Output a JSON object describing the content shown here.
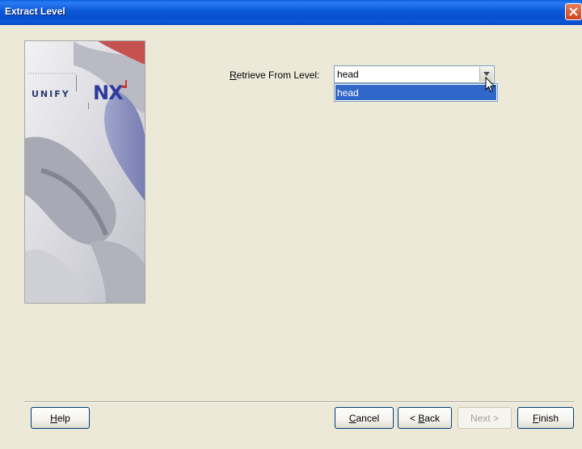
{
  "window": {
    "title": "Extract Level"
  },
  "banner": {
    "logo_word": "UNIFY",
    "logo_nx": "NX"
  },
  "form": {
    "label_mnemonic": "R",
    "label_rest": "etrieve From Level:",
    "combo_value": "head",
    "options": [
      "head"
    ],
    "highlighted_option": "head"
  },
  "buttons": {
    "help": {
      "mnemonic": "H",
      "rest": "elp"
    },
    "cancel": {
      "mnemonic": "C",
      "rest": "ancel"
    },
    "back": {
      "prefix": "< ",
      "mnemonic": "B",
      "rest": "ack"
    },
    "next": {
      "label": "Next >",
      "enabled": false
    },
    "finish": {
      "mnemonic": "F",
      "rest": "inish"
    }
  },
  "colors": {
    "dialog_bg": "#ece9d8",
    "titlebar": "#0b58d8",
    "selection": "#3167c8",
    "close": "#d2431f"
  }
}
